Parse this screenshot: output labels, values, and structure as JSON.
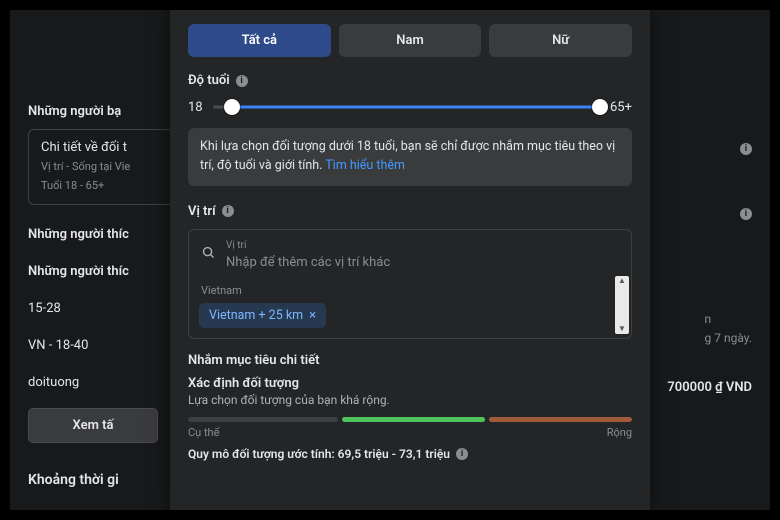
{
  "bg": {
    "left_hdr1": "Những người bạ",
    "card_title": "Chi tiết về đối t",
    "card_sub1": "Vị trí - Sống tại Vie",
    "card_sub2": "Tuổi 18 - 65+",
    "left_hdr2": "Những người thíc",
    "left_hdr3": "Những người thíc",
    "row1": "15-28",
    "row2": "VN - 18-40",
    "row3": "doituong",
    "btn": "Xem tấ",
    "section": "Khoảng thời gi",
    "right_info_icon": "i",
    "right_n": "n",
    "right_7": "g 7 ngày.",
    "right_result": "700000 ₫ VND"
  },
  "gender": {
    "all": "Tất cả",
    "male": "Nam",
    "female": "Nữ"
  },
  "age": {
    "label": "Độ tuổi",
    "min": "18",
    "max": "65+"
  },
  "note": {
    "text": "Khi lựa chọn đối tượng dưới 18 tuổi, bạn sẽ chỉ được nhắm mục tiêu theo vị trí, độ tuổi và giới tính. ",
    "link": "Tìm hiểu thêm"
  },
  "location": {
    "label": "Vị trí",
    "small": "Vị trí",
    "placeholder": "Nhập để thêm các vị trí khác",
    "country": "Vietnam",
    "chip": "Vietnam  + 25 km",
    "chip_close": "×"
  },
  "detail": {
    "section": "Nhắm mục tiêu chi tiết",
    "title": "Xác định đối tượng",
    "sub": "Lựa chọn đối tượng của bạn khá rộng.",
    "left": "Cụ thể",
    "right": "Rộng",
    "estimate": "Quy mô đối tượng ước tính: 69,5 triệu - 73,1 triệu"
  },
  "icons": {
    "info": "i"
  }
}
